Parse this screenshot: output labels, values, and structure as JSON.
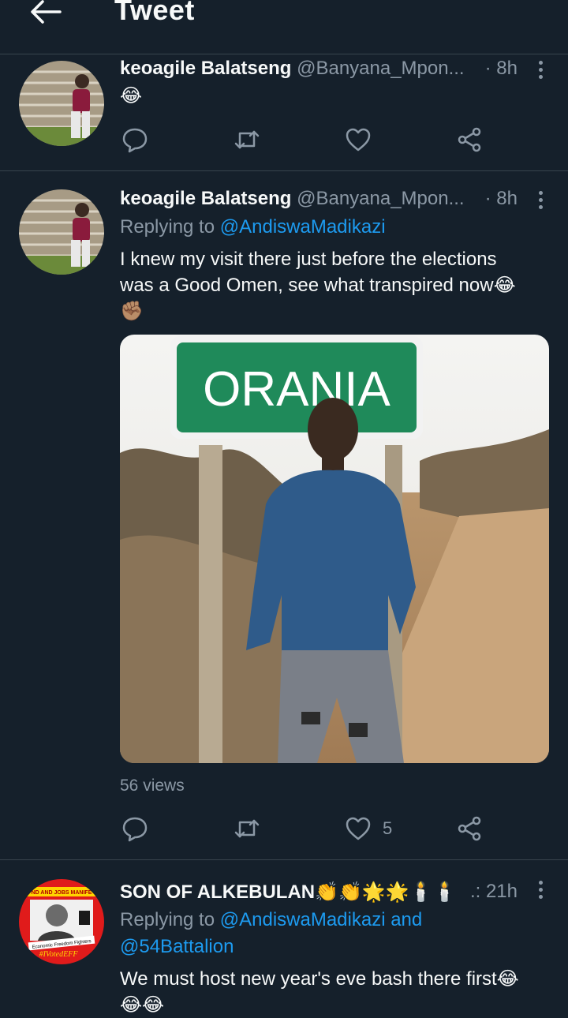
{
  "header": {
    "title": "Tweet",
    "back_icon": "arrow-left-icon"
  },
  "colors": {
    "background": "#15202b",
    "link": "#1d9bf0",
    "muted": "#8b98a5",
    "divider": "#38444d"
  },
  "tweets": [
    {
      "name": "keoagile Balatseng",
      "handle": "@Banyana_Mpon...",
      "time": "· 8h",
      "text": "😂"
    },
    {
      "name": "keoagile Balatseng",
      "handle": "@Banyana_Mpon...",
      "time": "· 8h",
      "reply_prefix": "Replying to",
      "reply_to": "@AndiswaMadikazi",
      "text_line1": "I knew my visit there just before the elections",
      "text_line2": "was a Good Omen, see what transpired now😂",
      "text_line3": "✊🏽",
      "media_sign": "ORANIA",
      "views": "56 views",
      "likes": "5"
    },
    {
      "name": "SON OF ALKEBULAN👏👏🌟🌟🕯️🕯️",
      "time": ".: 21h",
      "reply_prefix": "Replying to",
      "reply_to": "@AndiswaMadikazi and",
      "reply_to2": "@54Battalion",
      "text_line1": "We must host new year's eve bash there first😂",
      "text_line2": "😂😂",
      "avatar_text_top": "ND AND JOBS MANIFE",
      "avatar_text_mid": "Economic Freedom Fighters",
      "avatar_text_bottom": "#IVotedEFF"
    }
  ]
}
